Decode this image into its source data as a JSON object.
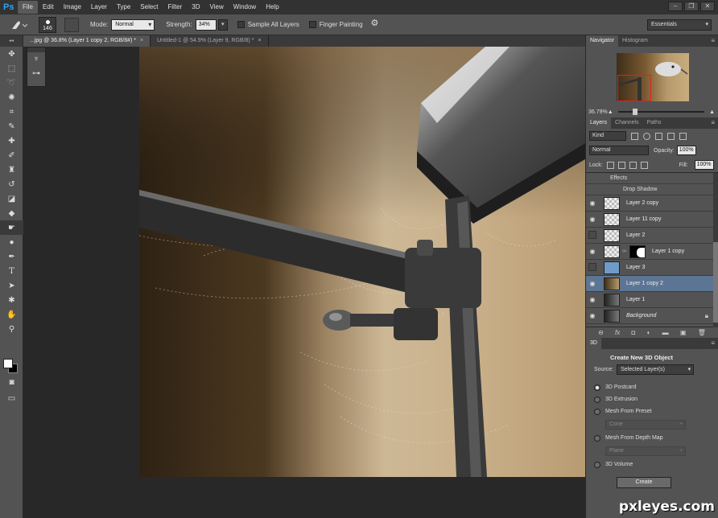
{
  "app": {
    "logo": "Ps"
  },
  "menu": [
    "File",
    "Edit",
    "Image",
    "Layer",
    "Type",
    "Select",
    "Filter",
    "3D",
    "View",
    "Window",
    "Help"
  ],
  "window_controls": {
    "minimize": "–",
    "restore": "❐",
    "close": "✕"
  },
  "options": {
    "brush_size": "146",
    "mode_label": "Mode:",
    "mode_value": "Normal",
    "strength_label": "Strength:",
    "strength_value": "34%",
    "sample_all_layers": "Sample All Layers",
    "finger_painting": "Finger Painting",
    "workspace": "Essentials"
  },
  "tabs": [
    {
      "label": "...jpg @ 36.8% (Layer 1 copy 2, RGB/8#) *",
      "close": "×"
    },
    {
      "label": "Untitled-1 @ 54.9% (Layer 9, RGB/8) *",
      "close": "×"
    }
  ],
  "navigator": {
    "tabs": [
      "Navigator",
      "Histogram"
    ],
    "zoom": "36.79%"
  },
  "layers_panel": {
    "tabs": [
      "Layers",
      "Channels",
      "Paths"
    ],
    "kind": "Kind",
    "blend_mode": "Normal",
    "opacity_label": "Opacity:",
    "opacity": "100%",
    "lock_label": "Lock:",
    "fill_label": "Fill:",
    "fill": "100%",
    "effects": "Effects",
    "drop_shadow": "Drop Shadow",
    "layers": [
      {
        "name": "Layer 2 copy",
        "visible": true
      },
      {
        "name": "Layer 11 copy",
        "visible": true
      },
      {
        "name": "Layer 2",
        "visible": false
      },
      {
        "name": "Layer 1 copy",
        "visible": true
      },
      {
        "name": "Layer 3",
        "visible": false
      },
      {
        "name": "Layer 1 copy 2",
        "visible": true,
        "selected": true
      },
      {
        "name": "Layer 1",
        "visible": true
      },
      {
        "name": "Background",
        "visible": true,
        "locked": true
      }
    ]
  },
  "threed": {
    "tab": "3D",
    "title": "Create New 3D Object",
    "source_label": "Source:",
    "source_value": "Selected Layer(s)",
    "options": [
      "3D Postcard",
      "3D Extrusion",
      "Mesh From Preset",
      "Mesh From Depth Map",
      "3D Volume"
    ],
    "preset_value": "Cone",
    "depth_value": "Plane",
    "create": "Create"
  },
  "watermark": "pxleyes.com",
  "colors": {
    "selected_layer": "#5d7594",
    "ps_blue": "#2fa3f5"
  }
}
